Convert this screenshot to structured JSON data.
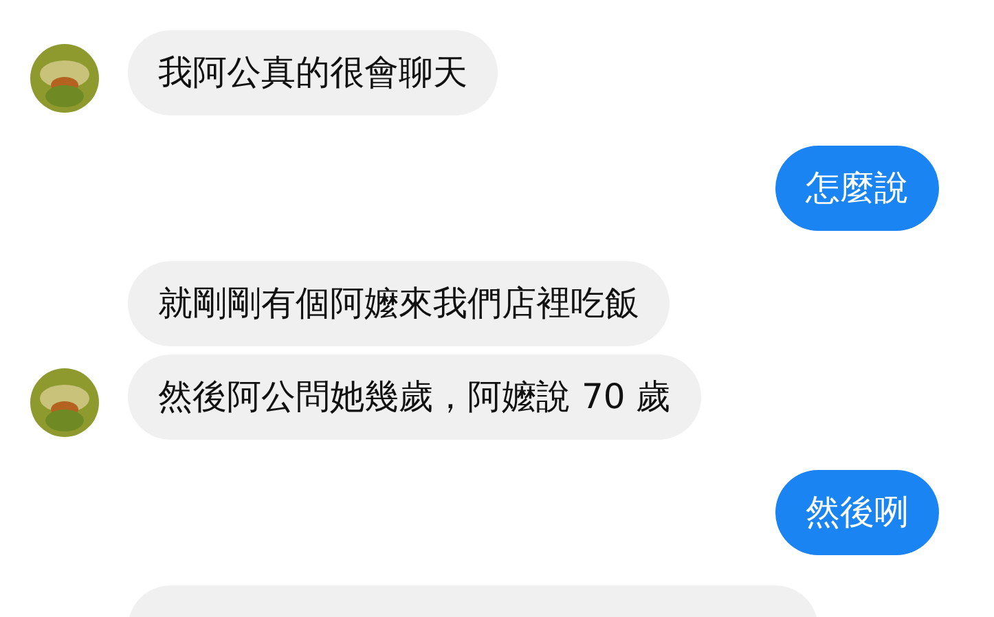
{
  "messages": [
    {
      "kind": "incoming",
      "show_avatar": true,
      "text": "我阿公真的很會聊天"
    },
    {
      "kind": "outgoing",
      "show_avatar": false,
      "text": "怎麼說"
    },
    {
      "kind": "incoming",
      "show_avatar": false,
      "text": "就剛剛有個阿嬤來我們店裡吃飯"
    },
    {
      "kind": "incoming",
      "show_avatar": true,
      "text": "然後阿公問她幾歲，阿嬤說 70 歲"
    },
    {
      "kind": "outgoing",
      "show_avatar": false,
      "text": "然後咧"
    },
    {
      "kind": "incoming",
      "show_avatar": false
    }
  ]
}
